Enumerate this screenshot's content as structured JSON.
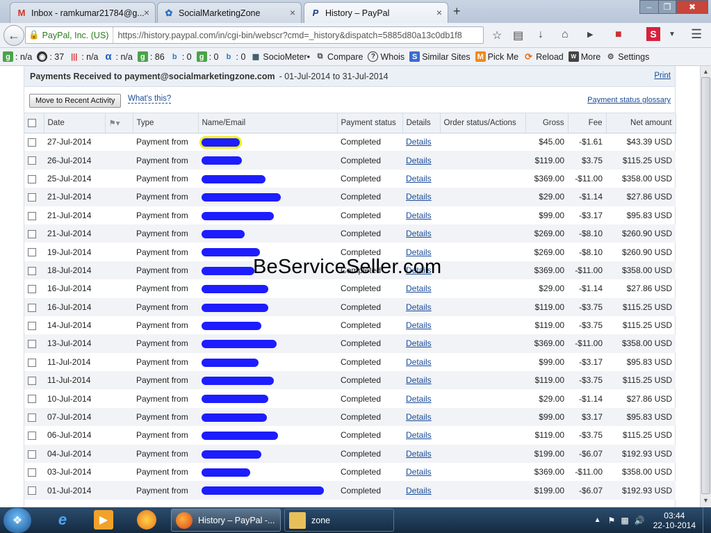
{
  "tabs": [
    {
      "title": "Inbox - ramkumar21784@g...",
      "icon": "gmail-icon",
      "active": false
    },
    {
      "title": "SocialMarketingZone",
      "icon": "paw-icon",
      "active": false
    },
    {
      "title": "History – PayPal",
      "icon": "paypal-icon",
      "active": true
    }
  ],
  "newtab_label": "+",
  "close_glyph": "×",
  "window_controls": {
    "minimize": "–",
    "maximize": "❐",
    "close": "✖"
  },
  "navbar": {
    "identity": "PayPal, Inc. (US)",
    "url": "https://history.paypal.com/in/cgi-bin/webscr?cmd=_history&dispatch=5885d80a13c0db1f8"
  },
  "bookmarks": [
    {
      "icon": "google-icon",
      "label": ": n/a"
    },
    {
      "icon": "compete-icon",
      "label": ": 37"
    },
    {
      "icon": "dmoz-icon",
      "label": ": n/a"
    },
    {
      "icon": "alexa-icon",
      "label": ": n/a"
    },
    {
      "icon": "google-icon",
      "label": ": 86"
    },
    {
      "icon": "bing-icon",
      "label": ": 0"
    },
    {
      "icon": "google-icon",
      "label": ": 0"
    },
    {
      "icon": "bing-icon",
      "label": ": 0"
    },
    {
      "icon": "chart-icon",
      "label": "SocioMeter•"
    },
    {
      "icon": "compare-icon",
      "label": "Compare"
    },
    {
      "icon": "question-icon",
      "label": "Whois"
    },
    {
      "icon": "similar-icon",
      "label": "Similar Sites"
    },
    {
      "icon": "pick-icon",
      "label": "Pick Me"
    },
    {
      "icon": "reload-icon",
      "label": "Reload"
    },
    {
      "icon": "more-icon",
      "label": "More"
    },
    {
      "icon": "settings-icon",
      "label": "Settings"
    }
  ],
  "header": {
    "title": "Payments Received to payment@socialmarketingzone.com",
    "range": "- 01-Jul-2014 to 31-Jul-2014",
    "print_label": "Print"
  },
  "actions": {
    "recent_activity_label": "Move to Recent Activity",
    "whats_this_label": "What's this?",
    "glossary_label": "Payment status glossary"
  },
  "columns": [
    "Date",
    "Type",
    "Name/Email",
    "Payment status",
    "Details",
    "Order status/Actions",
    "Gross",
    "Fee",
    "Net amount"
  ],
  "rows": [
    {
      "date": "27-Jul-2014",
      "type": "Payment from",
      "status": "Completed",
      "details": "Details",
      "gross": "$45.00",
      "fee": "-$1.61",
      "net": "$43.39 USD"
    },
    {
      "date": "26-Jul-2014",
      "type": "Payment from",
      "status": "Completed",
      "details": "Details",
      "gross": "$119.00",
      "fee": "$3.75",
      "net": "$115.25 USD"
    },
    {
      "date": "25-Jul-2014",
      "type": "Payment from",
      "status": "Completed",
      "details": "Details",
      "gross": "$369.00",
      "fee": "-$11.00",
      "net": "$358.00 USD"
    },
    {
      "date": "21-Jul-2014",
      "type": "Payment from",
      "status": "Completed",
      "details": "Details",
      "gross": "$29.00",
      "fee": "-$1.14",
      "net": "$27.86 USD"
    },
    {
      "date": "21-Jul-2014",
      "type": "Payment from",
      "status": "Completed",
      "details": "Details",
      "gross": "$99.00",
      "fee": "-$3.17",
      "net": "$95.83 USD"
    },
    {
      "date": "21-Jul-2014",
      "type": "Payment from",
      "status": "Completed",
      "details": "Details",
      "gross": "$269.00",
      "fee": "-$8.10",
      "net": "$260.90 USD"
    },
    {
      "date": "19-Jul-2014",
      "type": "Payment from",
      "status": "Completed",
      "details": "Details",
      "gross": "$269.00",
      "fee": "-$8.10",
      "net": "$260.90 USD"
    },
    {
      "date": "18-Jul-2014",
      "type": "Payment from",
      "status": "Completed",
      "details": "Details",
      "gross": "$369.00",
      "fee": "-$11.00",
      "net": "$358.00 USD"
    },
    {
      "date": "16-Jul-2014",
      "type": "Payment from",
      "status": "Completed",
      "details": "Details",
      "gross": "$29.00",
      "fee": "-$1.14",
      "net": "$27.86 USD"
    },
    {
      "date": "16-Jul-2014",
      "type": "Payment from",
      "status": "Completed",
      "details": "Details",
      "gross": "$119.00",
      "fee": "-$3.75",
      "net": "$115.25 USD"
    },
    {
      "date": "14-Jul-2014",
      "type": "Payment from",
      "status": "Completed",
      "details": "Details",
      "gross": "$119.00",
      "fee": "-$3.75",
      "net": "$115.25 USD"
    },
    {
      "date": "13-Jul-2014",
      "type": "Payment from",
      "status": "Completed",
      "details": "Details",
      "gross": "$369.00",
      "fee": "-$11.00",
      "net": "$358.00 USD"
    },
    {
      "date": "11-Jul-2014",
      "type": "Payment from",
      "status": "Completed",
      "details": "Details",
      "gross": "$99.00",
      "fee": "-$3.17",
      "net": "$95.83 USD"
    },
    {
      "date": "11-Jul-2014",
      "type": "Payment from",
      "status": "Completed",
      "details": "Details",
      "gross": "$119.00",
      "fee": "-$3.75",
      "net": "$115.25 USD"
    },
    {
      "date": "10-Jul-2014",
      "type": "Payment from",
      "status": "Completed",
      "details": "Details",
      "gross": "$29.00",
      "fee": "-$1.14",
      "net": "$27.86 USD"
    },
    {
      "date": "07-Jul-2014",
      "type": "Payment from",
      "status": "Completed",
      "details": "Details",
      "gross": "$99.00",
      "fee": "$3.17",
      "net": "$95.83 USD"
    },
    {
      "date": "06-Jul-2014",
      "type": "Payment from",
      "status": "Completed",
      "details": "Details",
      "gross": "$119.00",
      "fee": "-$3.75",
      "net": "$115.25 USD"
    },
    {
      "date": "04-Jul-2014",
      "type": "Payment from",
      "status": "Completed",
      "details": "Details",
      "gross": "$199.00",
      "fee": "-$6.07",
      "net": "$192.93 USD"
    },
    {
      "date": "03-Jul-2014",
      "type": "Payment from",
      "status": "Completed",
      "details": "Details",
      "gross": "$369.00",
      "fee": "-$11.00",
      "net": "$358.00 USD"
    },
    {
      "date": "01-Jul-2014",
      "type": "Payment from",
      "status": "Completed",
      "details": "Details",
      "gross": "$199.00",
      "fee": "-$6.07",
      "net": "$192.93 USD"
    }
  ],
  "watermark": "BeServiceSeller.com",
  "taskbar": {
    "tasks": [
      {
        "icon": "firefox-icon",
        "label": "History – PayPal -..."
      },
      {
        "icon": "folder-icon",
        "label": "zone"
      }
    ],
    "time": "03:44",
    "date": "22-10-2014"
  },
  "colors": {
    "link": "#1a4b97",
    "redaction": "#1d1dff",
    "highlight": "#f3f000",
    "identity": "#2b7a1f"
  }
}
